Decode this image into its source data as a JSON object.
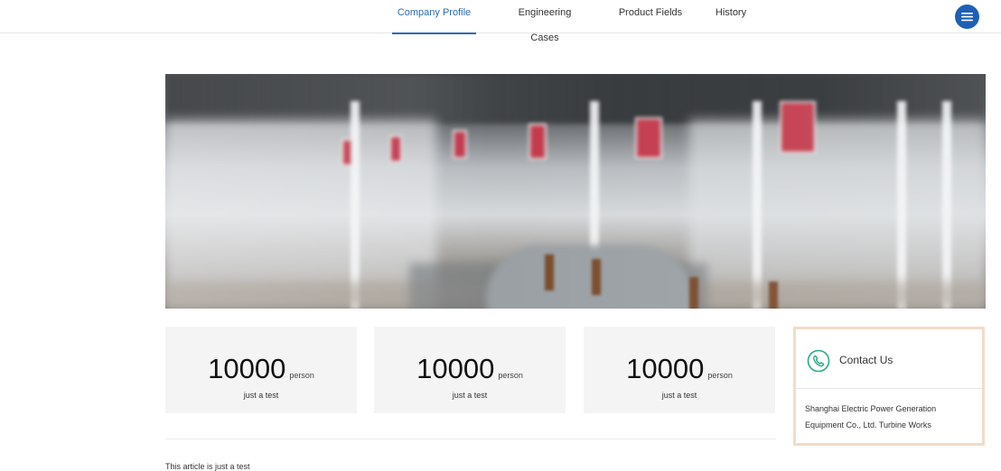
{
  "nav": {
    "tabs": [
      {
        "label": "Company Profile",
        "active": true
      },
      {
        "label": "Engineering Cases",
        "active": false
      },
      {
        "label": "Product Fields",
        "active": false
      },
      {
        "label": "History",
        "active": false
      }
    ],
    "menu_icon": "hamburger-menu-icon",
    "accent_color": "#1f5fb5",
    "active_tab_color": "#2c6ab0"
  },
  "hero": {
    "image": "factory-hall-photo"
  },
  "stats": [
    {
      "value": "10000",
      "unit": "person",
      "caption": "just a test"
    },
    {
      "value": "10000",
      "unit": "person",
      "caption": "just a test"
    },
    {
      "value": "10000",
      "unit": "person",
      "caption": "just a test"
    }
  ],
  "contact": {
    "title": "Contact Us",
    "icon": "phone-icon",
    "address": "Shanghai Electric Power Generation Equipment Co., Ltd. Turbine Works",
    "border_color": "#f3dcc7",
    "icon_color": "#2aa88a"
  },
  "article": {
    "text": "This article is just a test"
  }
}
